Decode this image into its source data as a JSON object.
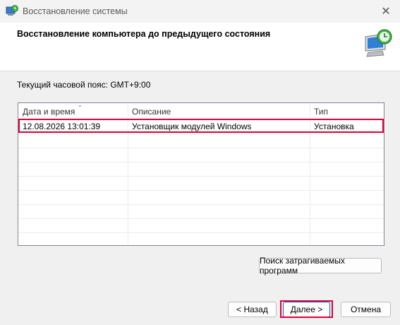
{
  "window": {
    "title": "Восстановление системы",
    "close_glyph": "✕"
  },
  "header": {
    "heading": "Восстановление компьютера до предыдущего состояния"
  },
  "timezone": {
    "label": "Текущий часовой пояс: GMT+9:00"
  },
  "table": {
    "columns": [
      "Дата и время",
      "Описание",
      "Тип"
    ],
    "rows": [
      {
        "date": "12.08.2026 13:01:39",
        "description": "Установщик модулей Windows",
        "type": "Установка"
      }
    ]
  },
  "buttons": {
    "scan": "Поиск затрагиваемых программ",
    "back": "< Назад",
    "next": "Далее >",
    "cancel": "Отмена"
  },
  "colors": {
    "highlight": "#e0003a",
    "accent": "#0067c0"
  }
}
